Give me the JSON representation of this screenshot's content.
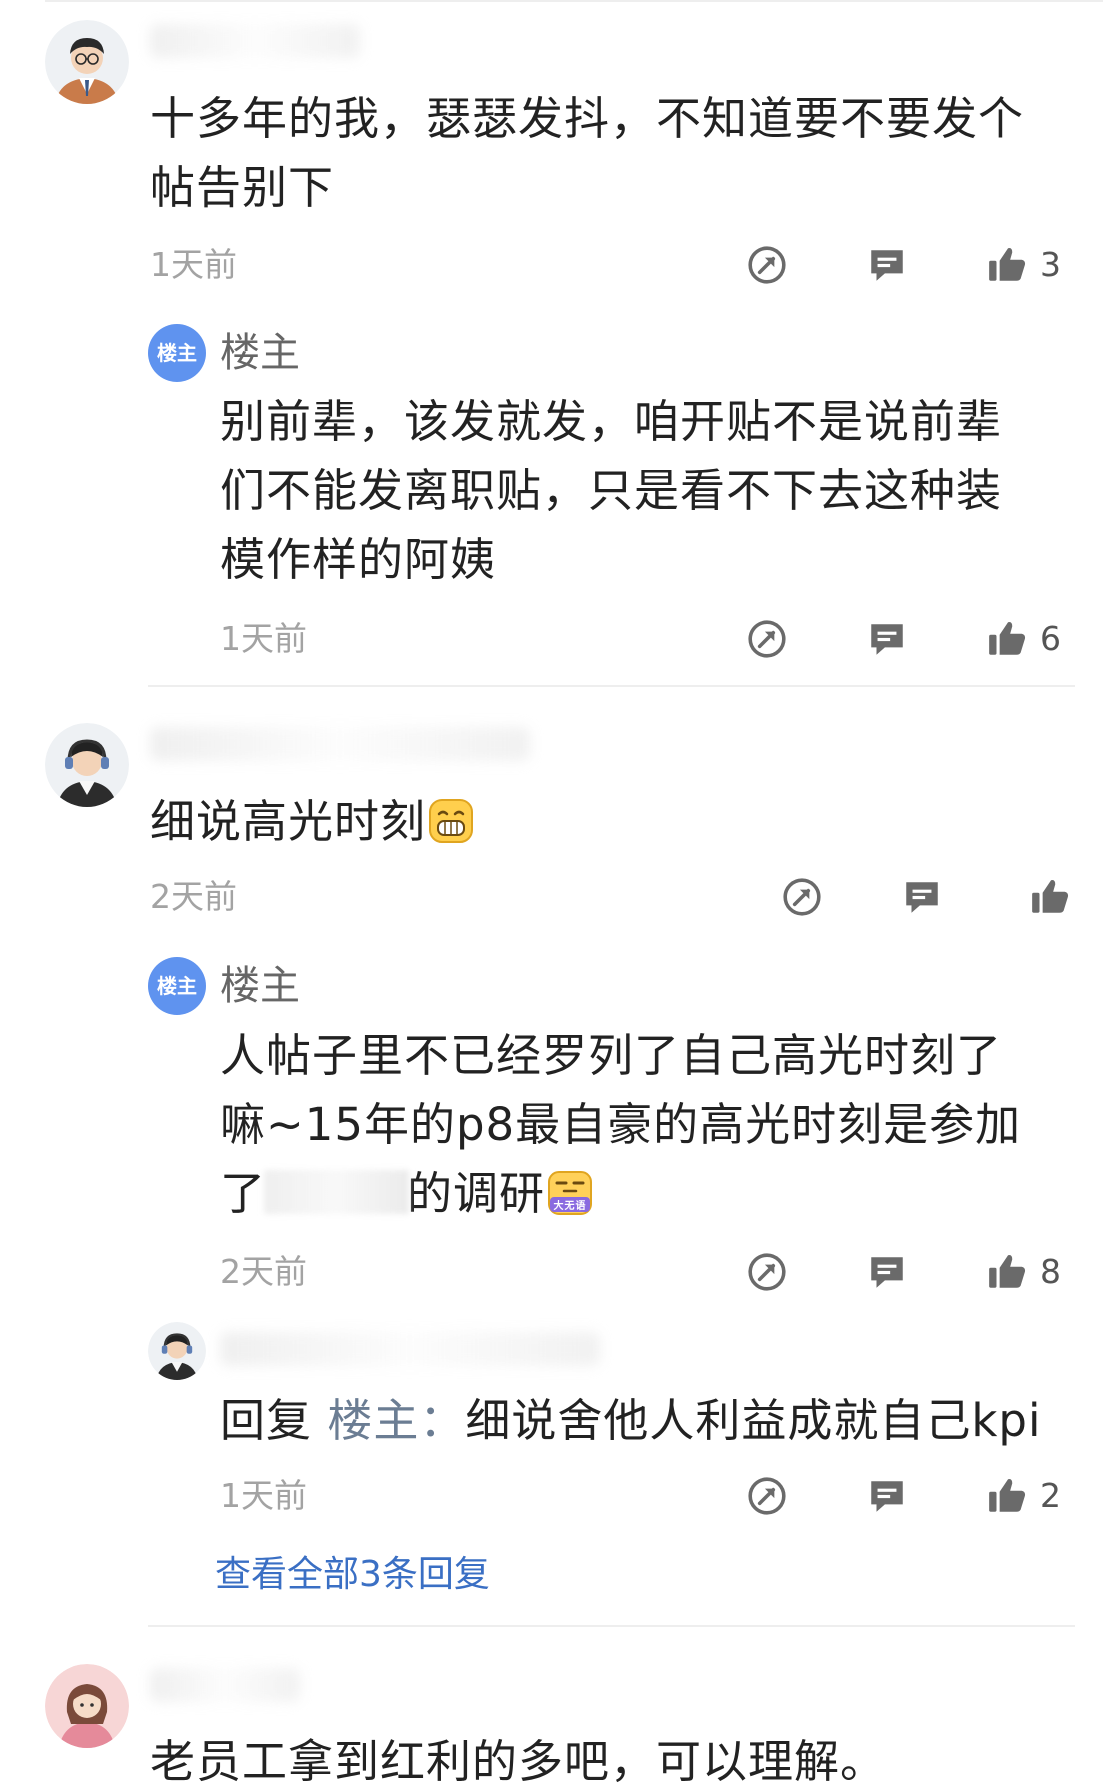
{
  "comments": [
    {
      "text_lines": [
        "十多年的我，瑟瑟发抖，不知道要不要发个",
        "帖告别下"
      ],
      "time": "1天前",
      "likes": "3",
      "replies": [
        {
          "author": "楼主",
          "badge": "楼主",
          "text_lines": [
            "别前辈，该发就发，咱开贴不是说前辈",
            "们不能发离职贴，只是看不下去这种装",
            "模作样的阿姨"
          ],
          "time": "1天前",
          "likes": "6"
        }
      ]
    },
    {
      "text": "细说高光时刻",
      "emoji": "grin-emoji",
      "time": "2天前",
      "likes": "",
      "replies": [
        {
          "author": "楼主",
          "badge": "楼主",
          "text_lines": [
            "人帖子里不已经罗列了自己高光时刻了",
            "嘛~15年的p8最自豪的高光时刻是参加"
          ],
          "line3_prefix": "了",
          "line3_suffix": "的调研",
          "sticker": "大无语",
          "time": "2天前",
          "likes": "8"
        },
        {
          "reply_word": "回复",
          "reply_to": "楼主",
          "reply_colon": "：",
          "text": "细说舍他人利益成就自己kpi",
          "time": "1天前",
          "likes": "2"
        }
      ],
      "view_all": "查看全部3条回复"
    },
    {
      "text": "老员工拿到红利的多吧，可以理解。"
    }
  ],
  "icons": {
    "share": "share-icon",
    "comment": "comment-icon",
    "like": "thumbs-up-icon"
  },
  "colors": {
    "badge": "#5f93ef",
    "link": "#3a6fc4",
    "meta": "#a3a3a3"
  }
}
